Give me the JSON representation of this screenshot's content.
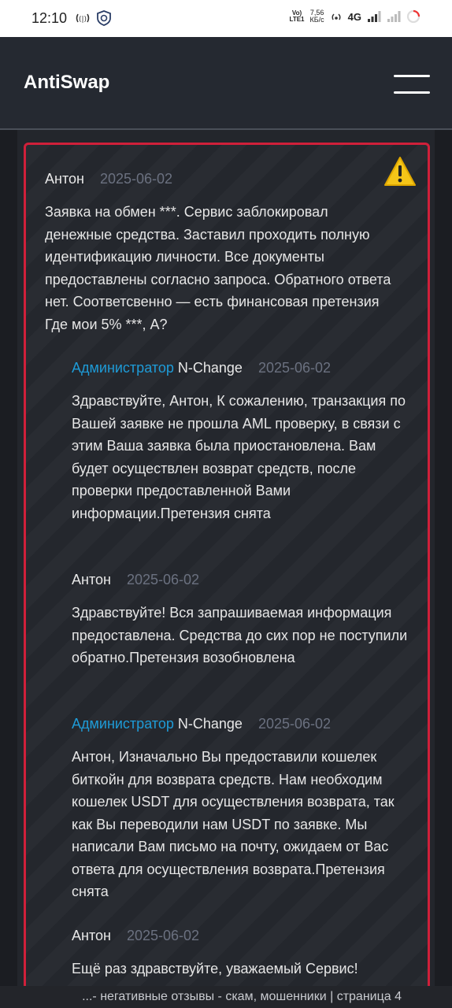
{
  "status_bar": {
    "time": "12:10",
    "volte_top": "Vo)",
    "volte_bottom": "LTE1",
    "speed_top": "7,56",
    "speed_bottom": "КБ/с",
    "network": "4G",
    "icons": [
      "hotspot-icon",
      "shield-app-icon",
      "hotspot-signal-icon",
      "cell-signal-icon",
      "cell-signal-weak-icon",
      "battery-ring-icon"
    ]
  },
  "header": {
    "logo": "AntiSwap",
    "menu_icon": "hamburger-menu-icon"
  },
  "card": {
    "border_color": "#d0203a",
    "warning_icon": "warning-triangle-icon",
    "comments": [
      {
        "author": "Антон",
        "date": "2025-06-02",
        "body": "Заявка на обмен ***. Сервис заблокировал денежные средства. Заставил проходить полную идентификацию личности. Все документы предоставлены согласно запроса. Обратного ответа нет. Соответсвенно — есть финансовая претензия Где мои 5% ***, А?"
      },
      {
        "role": "Администратор",
        "author": "N-Change",
        "date": "2025-06-02",
        "body": "Здравствуйте, Антон, К сожалению, транзакция по Вашей заявке не прошла AML проверку, в связи с этим Ваша заявка была приостановлена. Вам будет осуществлен возврат средств, после проверки предоставленной Вами информации.Претензия снята"
      },
      {
        "author": "Антон",
        "date": "2025-06-02",
        "body": "Здравствуйте! Вся запрашиваемая информация предоставлена. Средства до сих пор не поступили обратно.Претензия возобновлена"
      },
      {
        "role": "Администратор",
        "author": "N-Change",
        "date": "2025-06-02",
        "body": "Антон, Изначально Вы предоставили кошелек биткойн для возврата средств. Нам необходим кошелек USDT для осуществления возврата, так как Вы переводили нам USDT по заявке. Мы написали Вам письмо на почту, ожидаем от Вас ответа для осуществления возврата.Претензия снята"
      },
      {
        "author": "Антон",
        "date": "2025-06-02",
        "body": "Ещё раз здравствуйте, уважаемый Сервис!"
      }
    ]
  },
  "bottom_banner": {
    "text": "...- негативные отзывы - скам, мошенники | страница 4"
  },
  "colors": {
    "accent_link": "#1e9bd7",
    "date_gray": "#6b7180",
    "background": "#1b1d22",
    "header": "#252931"
  }
}
